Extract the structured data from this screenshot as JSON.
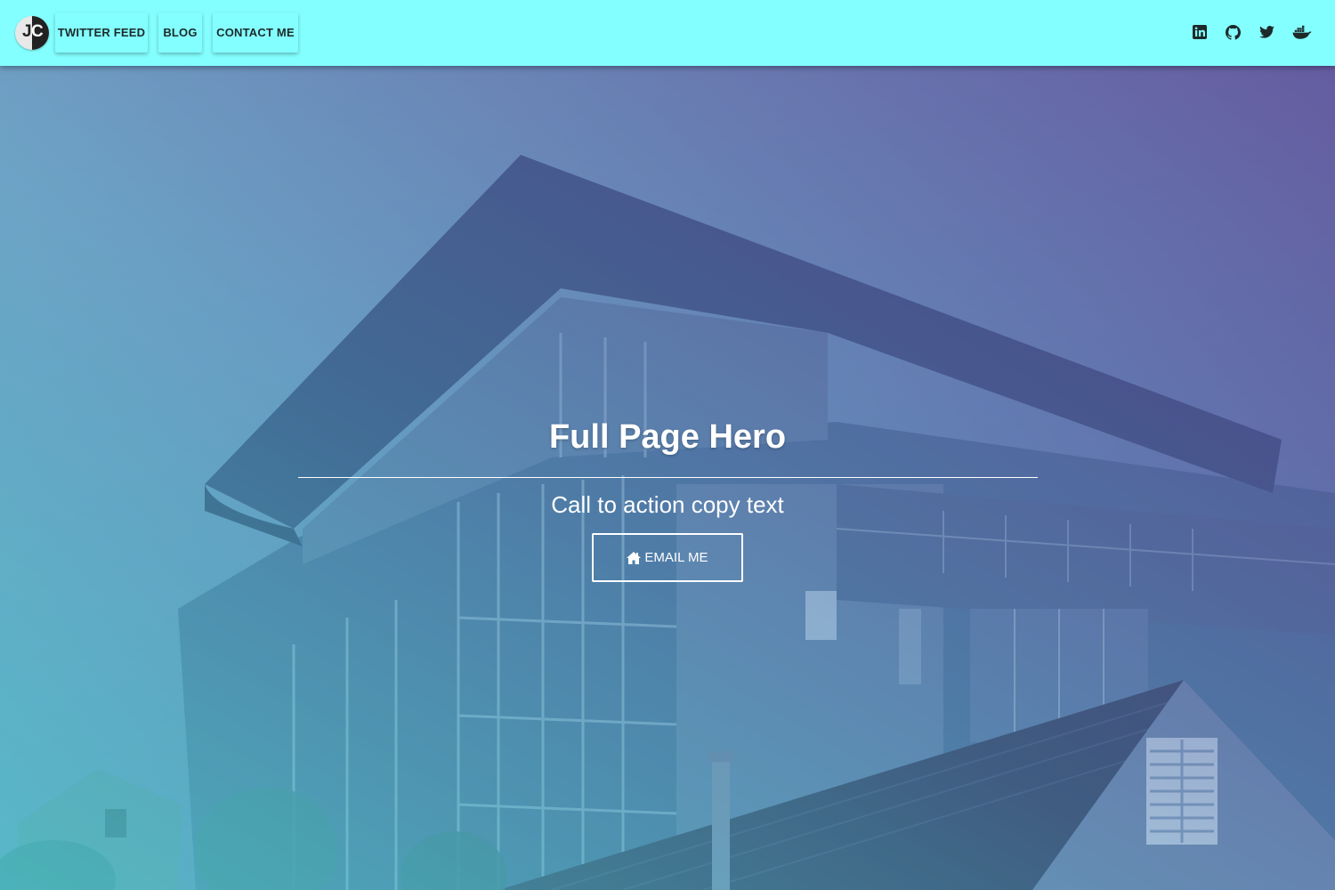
{
  "brand": {
    "logo_letters": [
      "J",
      "C"
    ]
  },
  "nav": [
    {
      "label": "TWITTER FEED"
    },
    {
      "label": "BLOG"
    },
    {
      "label": "CONTACT ME"
    }
  ],
  "social": [
    {
      "icon": "linkedin-icon"
    },
    {
      "icon": "github-icon"
    },
    {
      "icon": "twitter-icon"
    },
    {
      "icon": "docker-icon"
    }
  ],
  "hero": {
    "title": "Full Page Hero",
    "subtitle": "Call to action copy text",
    "cta_label": "EMAIL ME",
    "cta_icon": "home-icon"
  },
  "colors": {
    "topbar": "#84ffff",
    "overlay_start": "#50d2d2",
    "overlay_end": "#60328c",
    "text_light": "#ffffff"
  }
}
